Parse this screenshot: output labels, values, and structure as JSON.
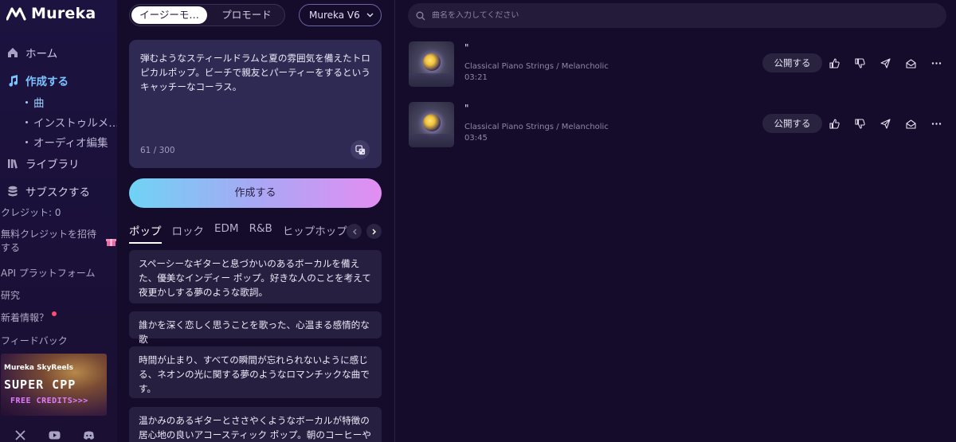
{
  "sidebar": {
    "logo": "Mureka",
    "nav": {
      "home": "ホーム",
      "create": "作成する",
      "library": "ライブラリ",
      "subscribe": "サブスクする"
    },
    "create_sub": [
      "曲",
      "インストゥルメ…",
      "オーディオ編集"
    ],
    "credits": "クレジット: 0",
    "invite": "無料クレジットを招待する",
    "api": "API プラットフォーム",
    "research": "研究",
    "news": "新着情報？",
    "feedback": "フィードバック",
    "promo": {
      "brands": "Mureka  SkyReels",
      "title": "SUPER CPP",
      "subtitle": "FREE CREDITS>>>"
    },
    "social_icons": [
      "x-icon",
      "youtube-icon",
      "discord-icon"
    ]
  },
  "composer": {
    "mode_easy": "イージーモ…",
    "mode_pro": "プロモード",
    "model": "Mureka V6",
    "prompt": "弾むようなスティールドラムと夏の雰囲気を備えたトロピカルポップ。ビーチで親友とパーティーをするというキャッチーなコーラス。",
    "char_count": "61 / 300",
    "create_button": "作成する",
    "genre_tabs": [
      "ポップ",
      "ロック",
      "EDM",
      "R&B",
      "ヒップホップ"
    ],
    "suggestions": [
      "スペーシーなギターと息づかいのあるボーカルを備えた、優美なインディー ポップ。好きな人のことを考えて夜更かしする夢のような歌詞。",
      "誰かを深く恋しく思うことを歌った、心温まる感情的な歌",
      "時間が止まり、すべての瞬間が忘れられないように感じる、ネオンの光に関する夢のようなロマンチックな曲です。",
      "温かみのあるギターとささやくようなボーカルが特徴の居心地の良いアコースティック ポップ。朝のコーヒーや週"
    ]
  },
  "library": {
    "search_placeholder": "曲名を入力してください",
    "tracks": [
      {
        "title": "\"",
        "style": "Classical Piano Strings / Melancholic",
        "duration": "03:21",
        "publish": "公開する"
      },
      {
        "title": "\"",
        "style": "Classical Piano Strings / Melancholic",
        "duration": "03:45",
        "publish": "公開する"
      }
    ]
  },
  "colors": {
    "background": "#150b2a",
    "accent_blue": "#7cc3ff",
    "gradient_start": "#6fd3f5",
    "gradient_end": "#e38df2"
  }
}
